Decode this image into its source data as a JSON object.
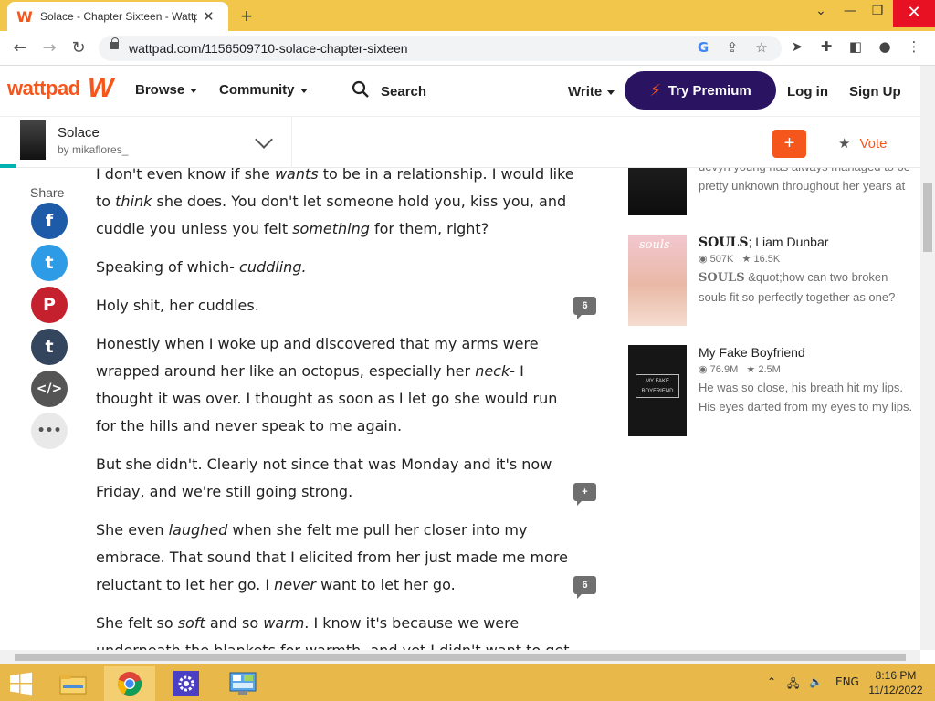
{
  "browser": {
    "tab_title": "Solace - Chapter Sixteen - Wattpad",
    "tab_close": "✕",
    "new_tab": "+",
    "url": "wattpad.com/1156509710-solace-chapter-sixteen",
    "win_min": "⌄",
    "win_restore": "—",
    "win_max": "❐",
    "win_close": "✕"
  },
  "header": {
    "logo": "wattpad",
    "browse_label": "Browse",
    "community_label": "Community",
    "search_label": "Search",
    "write_label": "Write",
    "premium_label": "Try Premium",
    "login_label": "Log in",
    "signup_label": "Sign Up"
  },
  "story": {
    "title": "Solace",
    "author": "by mikaflores_",
    "add_label": "+",
    "vote_label": "Vote"
  },
  "share": {
    "label": "Share",
    "buttons": [
      {
        "name": "facebook",
        "glyph": "f",
        "color": "#1d5aa7"
      },
      {
        "name": "twitter",
        "glyph": "t",
        "color": "#2d9be5"
      },
      {
        "name": "pinterest",
        "glyph": "P",
        "color": "#c5202e"
      },
      {
        "name": "tumblr",
        "glyph": "t",
        "color": "#34465d"
      },
      {
        "name": "embed",
        "glyph": "</>",
        "color": "#555555"
      },
      {
        "name": "more",
        "glyph": "•••",
        "color": "#e9e9e9"
      }
    ]
  },
  "content": {
    "p1a": "I don't even know if she ",
    "p1b": "wants",
    "p1c": " to be in a relationship. I would like to ",
    "p1d": "think",
    "p1e": " she does. You don't let someone hold you, kiss you, and cuddle you unless you felt ",
    "p1f": "something",
    "p1g": " for them, right?",
    "p2a": "Speaking of which- ",
    "p2b": "cuddling.",
    "p3": "Holy shit, her cuddles.",
    "p4a": "Honestly when I woke up and discovered that my arms were wrapped around her like an octopus, especially her ",
    "p4b": "neck",
    "p4c": "- I thought it was over. I thought as soon as I let go she would run for the hills and never speak to me again.",
    "p5": "But she didn't. Clearly not since that was Monday and it's now Friday, and we're still going strong.",
    "p6a": "She even ",
    "p6b": "laughed",
    "p6c": " when she felt me pull her closer into my embrace. That sound that I elicited from her just made me more reluctant to let her go. I ",
    "p6d": "never",
    "p6e": " want to let her go.",
    "p7a": "She felt so ",
    "p7b": "soft",
    "p7c": " and so ",
    "p7d": "warm",
    "p7e": ". I know it's because we were underneath the blankets for warmth, and yet I didn't want to get out of bed because I"
  },
  "comments": {
    "c1": "6",
    "c2": "+",
    "c3": "6"
  },
  "sidebar": {
    "rec0_desc": "devyn young has always managed to be pretty unknown throughout her years at",
    "rec1_title_bold": "SOULS",
    "rec1_title_rest": "; Liam Dunbar",
    "rec1_reads": "507K",
    "rec1_votes": "16.5K",
    "rec1_desc_bold": "SOULS",
    "rec1_desc_rest": " &quot;how can two broken souls fit so perfectly together as one?",
    "rec1_cover_text": "souls",
    "rec2_title": "My Fake Boyfriend",
    "rec2_reads": "76.9M",
    "rec2_votes": "2.5M",
    "rec2_desc": "He was so close, his breath hit my lips. His eyes darted from my eyes to my lips.",
    "rec2_cover_text": "MY FAKE BOYFRIEND"
  },
  "taskbar": {
    "lang": "ENG",
    "time": "8:16 PM",
    "date": "11/12/2022"
  },
  "colors": {
    "brand": "#f5561c",
    "premium": "#2a1462",
    "taskbar": "#e8b84a",
    "tabstrip": "#f1c64a"
  }
}
